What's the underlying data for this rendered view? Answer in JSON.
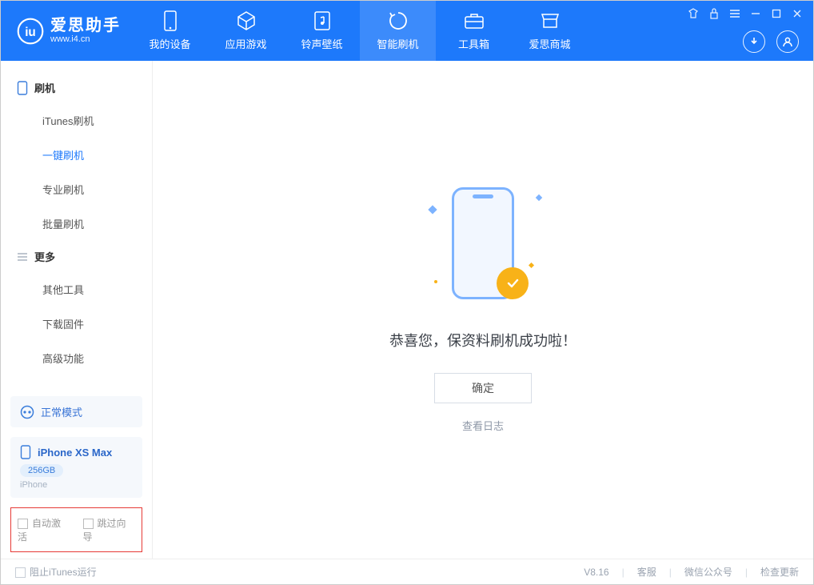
{
  "app": {
    "title": "爱思助手",
    "subtitle": "www.i4.cn"
  },
  "nav": {
    "tabs": [
      {
        "label": "我的设备",
        "icon": "device"
      },
      {
        "label": "应用游戏",
        "icon": "cube"
      },
      {
        "label": "铃声壁纸",
        "icon": "music"
      },
      {
        "label": "智能刷机",
        "icon": "refresh",
        "active": true
      },
      {
        "label": "工具箱",
        "icon": "toolbox"
      },
      {
        "label": "爱思商城",
        "icon": "store"
      }
    ]
  },
  "sidebar": {
    "group1_title": "刷机",
    "group1": [
      {
        "label": "iTunes刷机"
      },
      {
        "label": "一键刷机",
        "active": true
      },
      {
        "label": "专业刷机"
      },
      {
        "label": "批量刷机"
      }
    ],
    "group2_title": "更多",
    "group2": [
      {
        "label": "其他工具"
      },
      {
        "label": "下载固件"
      },
      {
        "label": "高级功能"
      }
    ],
    "mode_label": "正常模式",
    "device": {
      "name": "iPhone XS Max",
      "storage": "256GB",
      "type": "iPhone"
    },
    "checkbox1": "自动激活",
    "checkbox2": "跳过向导"
  },
  "main": {
    "success_text": "恭喜您，保资料刷机成功啦！",
    "ok_button": "确定",
    "log_link": "查看日志"
  },
  "footer": {
    "block_itunes": "阻止iTunes运行",
    "version": "V8.16",
    "links": [
      "客服",
      "微信公众号",
      "检查更新"
    ]
  }
}
